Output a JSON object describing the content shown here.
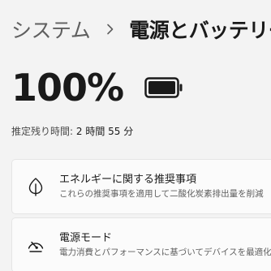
{
  "breadcrumb": {
    "parent": "システム",
    "current": "電源とバッテリー"
  },
  "battery": {
    "percent_label": "100%",
    "level": 1.0,
    "estimate_label": "推定残り時間:",
    "estimate_value": "2 時間 55 分"
  },
  "cards": [
    {
      "icon": "leaf-icon",
      "title": "エネルギーに関する推奨事項",
      "description": "これらの推奨事項を適用して二酸化炭素排出量を削減"
    },
    {
      "icon": "power-mode-icon",
      "title": "電源モード",
      "description": "電力消費とパフォーマンスに基づいてデバイスを最適化"
    }
  ]
}
